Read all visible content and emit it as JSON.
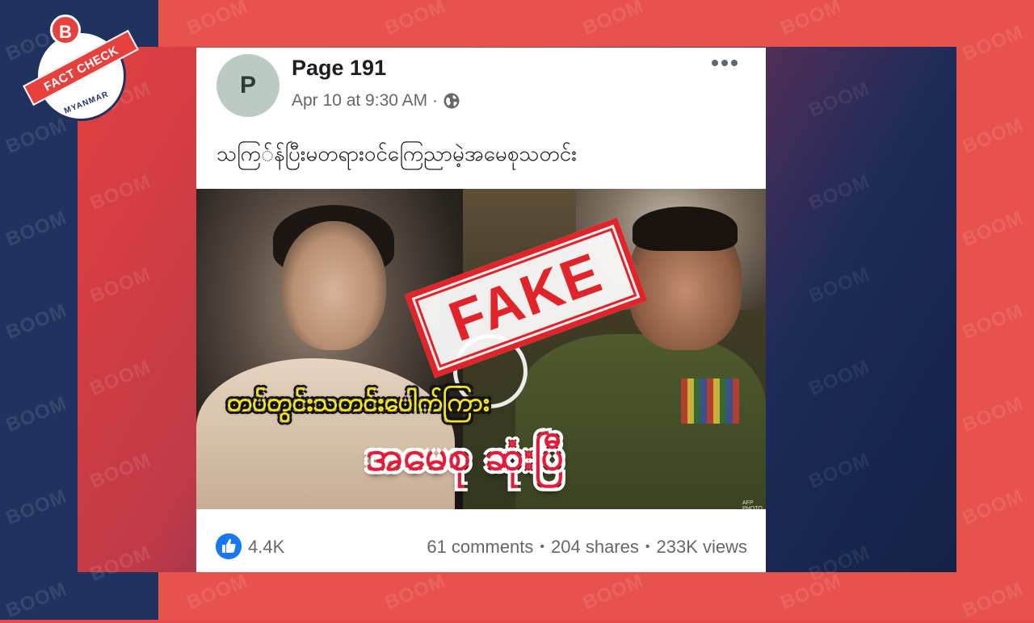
{
  "watermark": {
    "text": "BOOM"
  },
  "badge": {
    "letter": "B",
    "ribbon": "FACT CHECK",
    "subtitle": "MYANMAR"
  },
  "post": {
    "page_name": "Page 191",
    "avatar_letter": "P",
    "date": "Apr 10 at 9:30 AM",
    "privacy_icon": "globe-icon",
    "menu_icon": "more-options-icon",
    "text": "သကြ်န်ပြီးမတရားဝင်ကြေညာမဲ့အမေစုသတင်း"
  },
  "image": {
    "caption_line1": "တပ်တွင်းသတင်းပေါက်ကြား",
    "caption_line2": "အမေစု ဆုံးပြီ",
    "credit": "AFP PHOTO",
    "stamp": "FAKE",
    "stamp_color": "#e2242a"
  },
  "engagement": {
    "likes": "4.4K",
    "comments": "61 comments",
    "shares": "204 shares",
    "views": "233K views",
    "separator": "•"
  },
  "colors": {
    "boom_red": "#e8524c",
    "boom_navy": "#1f3260",
    "facebook_blue": "#1877f2"
  }
}
